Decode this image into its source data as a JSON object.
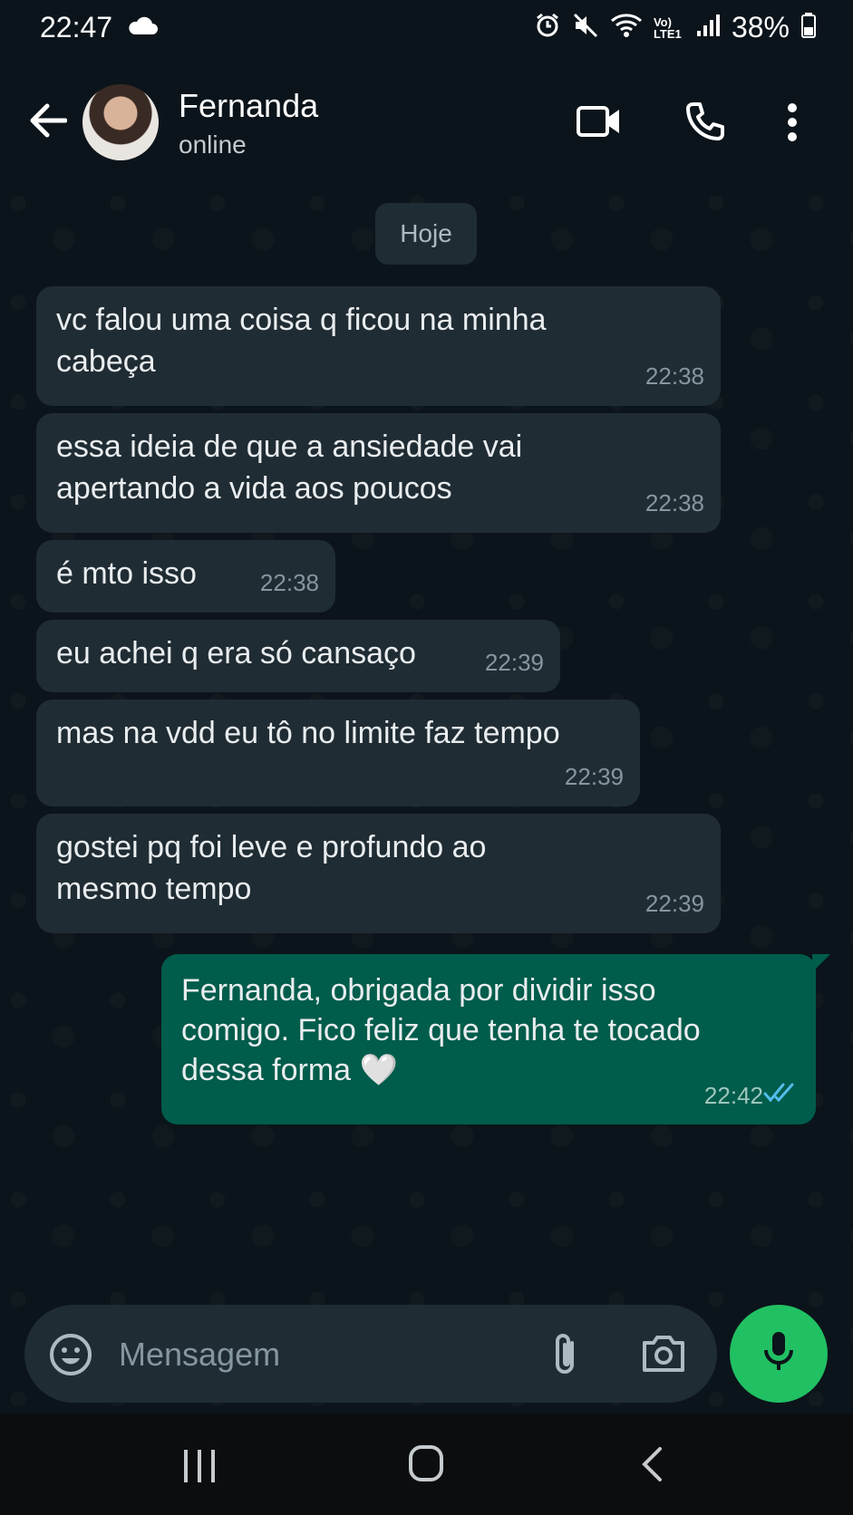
{
  "status_bar": {
    "time": "22:47",
    "battery": "38%",
    "network_label": "Vo) LTE1",
    "icons": [
      "cloud-icon",
      "alarm-icon",
      "mute-icon",
      "wifi-icon",
      "signal-icon",
      "battery-icon"
    ]
  },
  "header": {
    "contact_name": "Fernanda",
    "status": "online",
    "icons": [
      "back-arrow-icon",
      "video-call-icon",
      "voice-call-icon",
      "more-options-icon"
    ]
  },
  "chat": {
    "date_separator": "Hoje",
    "messages": [
      {
        "direction": "incoming",
        "text": "vc falou uma coisa q ficou na minha\ncabeça",
        "time": "22:38"
      },
      {
        "direction": "incoming",
        "text": "essa ideia de que a ansiedade vai\napertando a vida aos poucos",
        "time": "22:38"
      },
      {
        "direction": "incoming",
        "text": "é mto isso",
        "time": "22:38"
      },
      {
        "direction": "incoming",
        "text": "eu achei q era só cansaço",
        "time": "22:39"
      },
      {
        "direction": "incoming",
        "text": "mas na vdd eu tô no limite faz tempo",
        "time": "22:39"
      },
      {
        "direction": "incoming",
        "text": "gostei pq foi leve e profundo ao\nmesmo tempo",
        "time": "22:39"
      },
      {
        "direction": "outgoing",
        "text": "Fernanda, obrigada por dividir isso\ncomigo. Fico feliz que tenha te tocado\ndessa forma 🤍",
        "time": "22:42",
        "read_status": "read"
      }
    ]
  },
  "composer": {
    "placeholder": "Mensagem",
    "value": "",
    "icons": [
      "emoji-icon",
      "attach-icon",
      "camera-icon",
      "microphone-icon"
    ]
  },
  "nav_bar": {
    "icons": [
      "recents-icon",
      "home-icon",
      "nav-back-icon"
    ]
  },
  "colors": {
    "background": "#0b141a",
    "incoming_bubble": "#202c33",
    "outgoing_bubble": "#005c4b",
    "accent": "#21c063",
    "read_ticks": "#53bdeb"
  }
}
